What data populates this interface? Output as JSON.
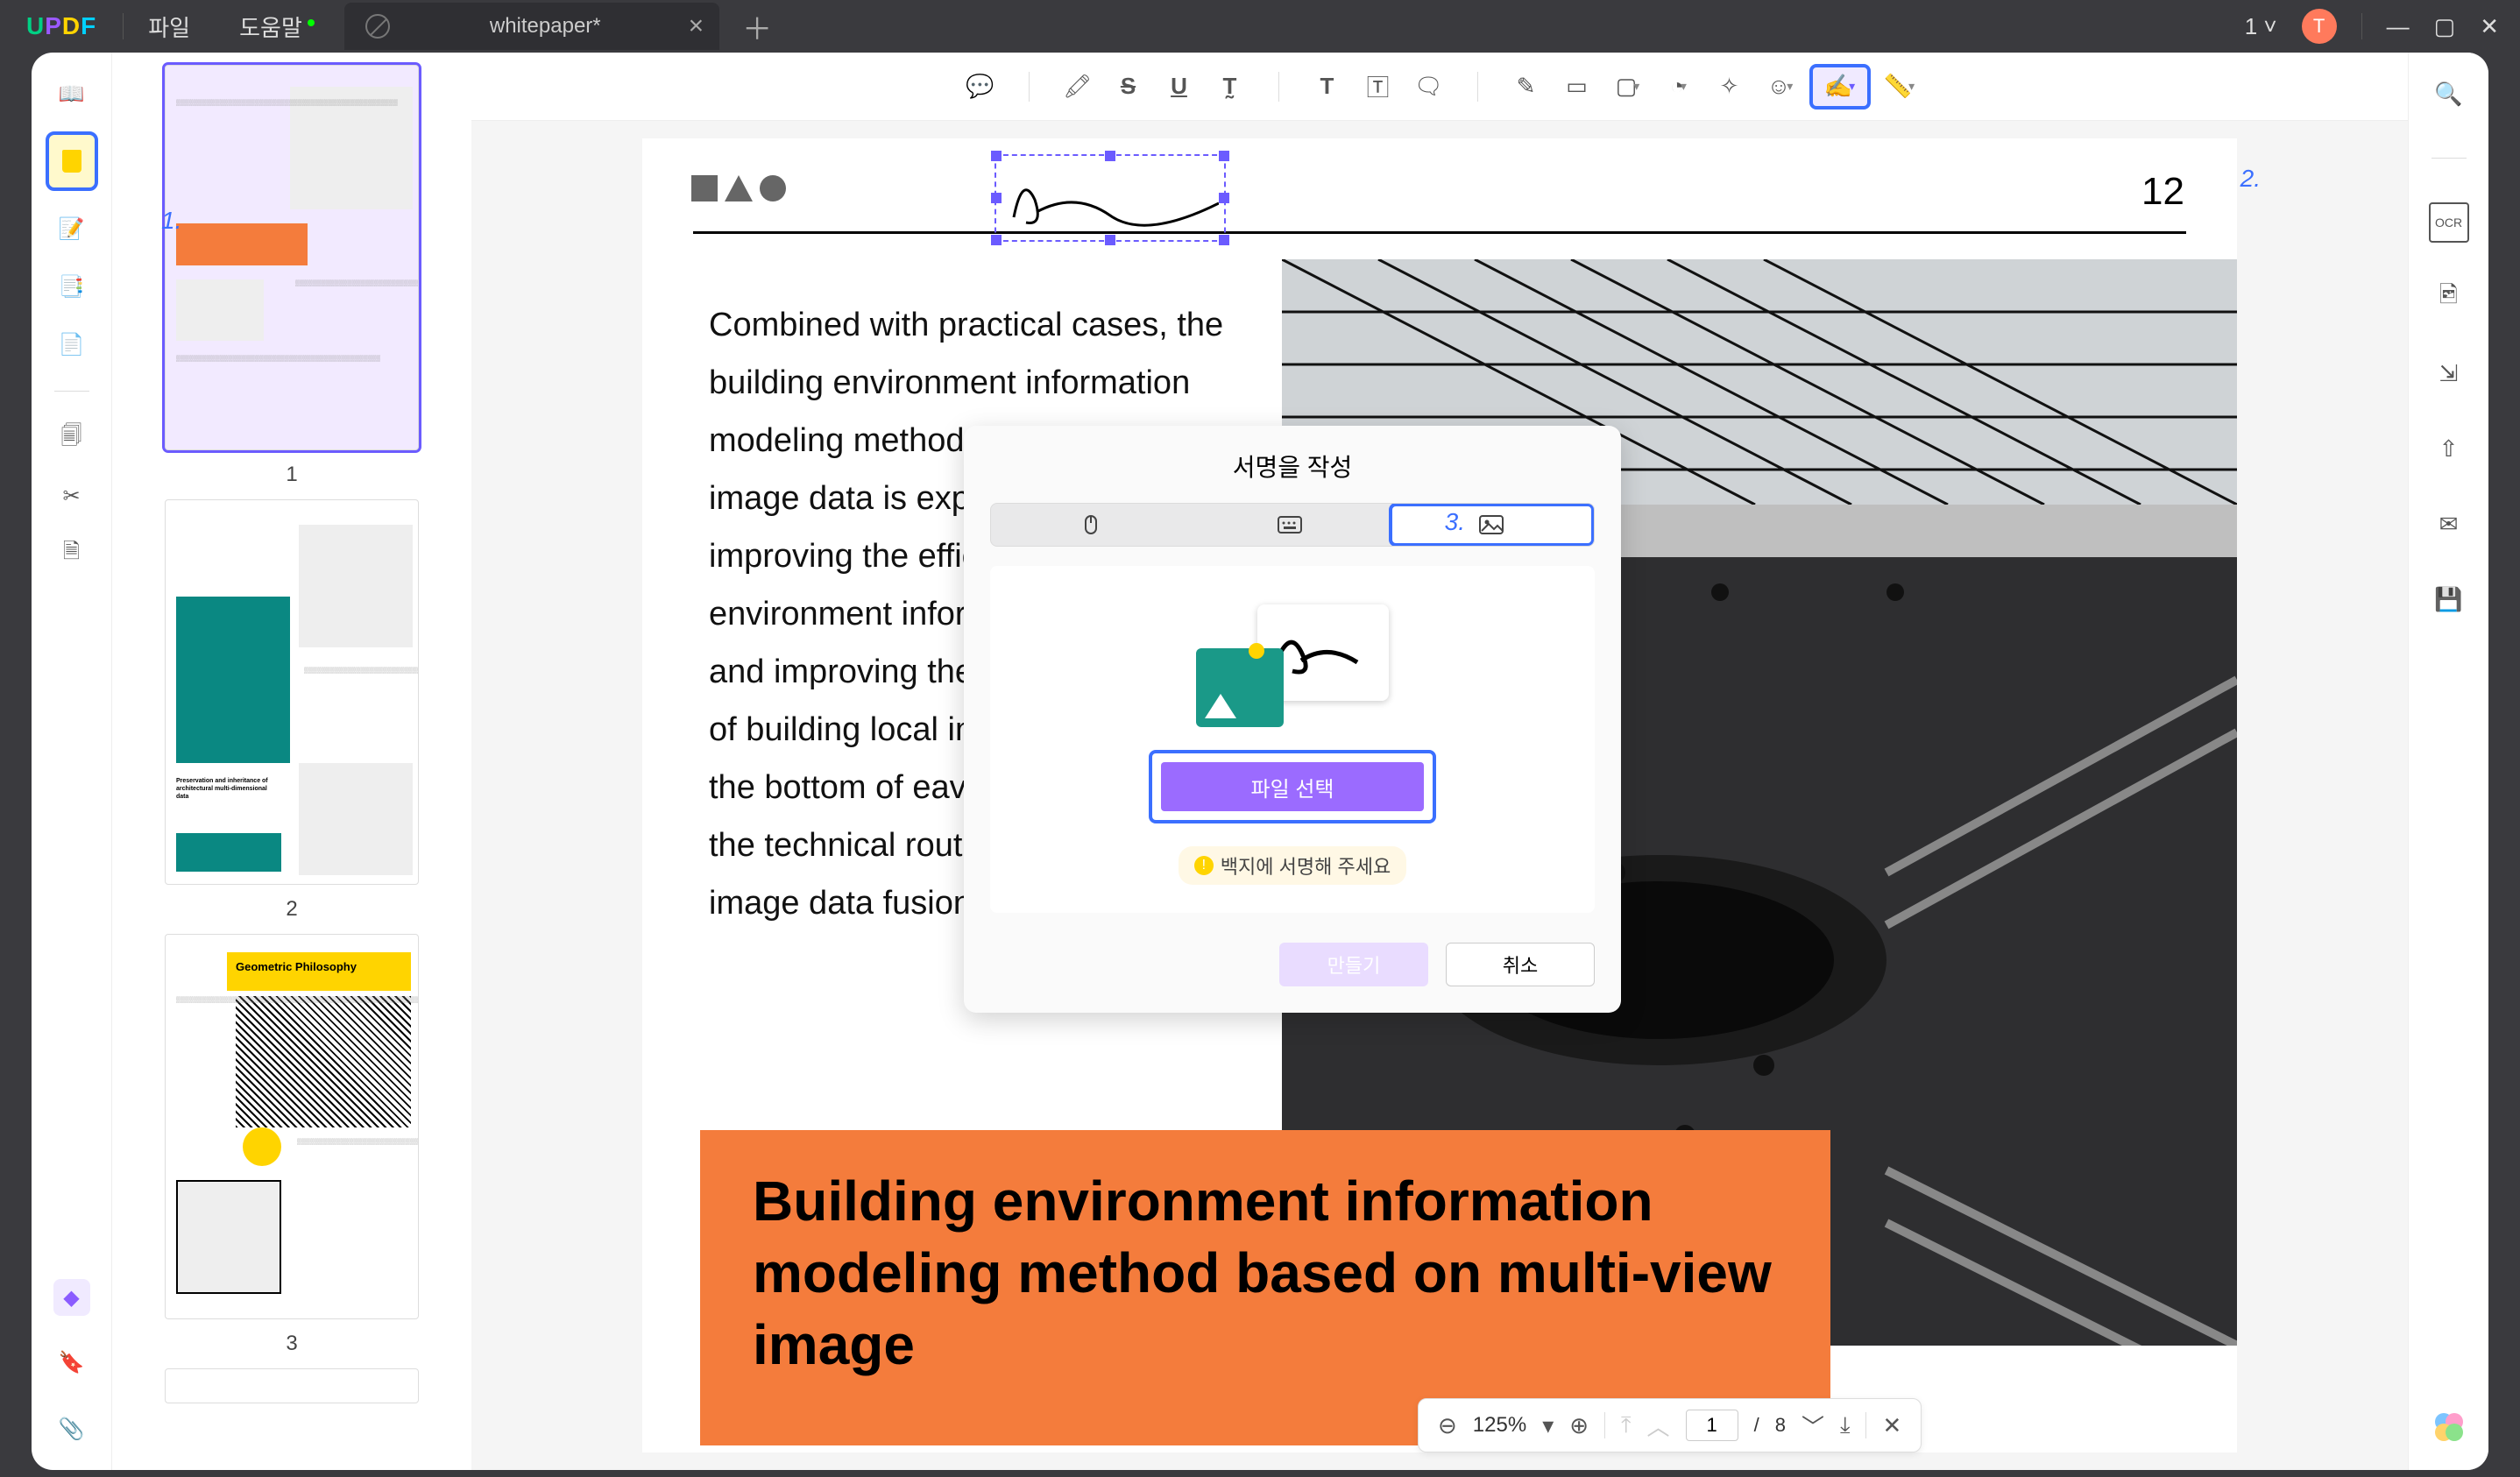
{
  "titlebar": {
    "menu_file": "파일",
    "menu_help": "도움말",
    "tab_title": "whitepaper*",
    "user_label": "1",
    "avatar_letter": "T"
  },
  "callouts": {
    "c1": "1.",
    "c2": "2.",
    "c3": "3."
  },
  "thumbs": {
    "p1": "1",
    "p2": "2",
    "p3": "3"
  },
  "page": {
    "number": "12",
    "body_text": "Combined with practical cases, the building environment information modeling method based on multi-view image data is explored, aiming at improving the efficiency of building environment information modeling and improving the modeling accuracy of building local information such as the bottom of eaves, and exploring the technical route of multi-view image data fusion.",
    "orange_heading": "Building environment information modeling method based on multi-view image"
  },
  "dialog": {
    "title": "서명을 작성",
    "file_select": "파일 선택",
    "tip": "백지에 서명해 주세요",
    "create": "만들기",
    "cancel": "취소"
  },
  "nav": {
    "zoom": "125%",
    "page_cur": "1",
    "page_sep": "/",
    "page_total": "8"
  },
  "icons": {
    "reader": "📖",
    "highlighter": "hl",
    "form": "📋",
    "menu": "📄",
    "editpage": "✎",
    "pages": "🗐",
    "crop": "✂",
    "ocrleft": "⌘",
    "comment": "💬",
    "marker": "🖍",
    "strike": "S",
    "underline": "U",
    "textstyle": "T",
    "text": "T",
    "textbox": "🅃",
    "callout": "⎘",
    "pencil": "✎",
    "eraser": "▭",
    "rect": "▢",
    "stamp": "◔",
    "pin": "✧",
    "sticker": "☺",
    "sign": "✍",
    "ruler": "📏",
    "search": "🔍",
    "ocr": "OCR",
    "scan": "🖻",
    "export": "⇩",
    "share": "⇪",
    "mail": "✉",
    "save": "💾"
  }
}
